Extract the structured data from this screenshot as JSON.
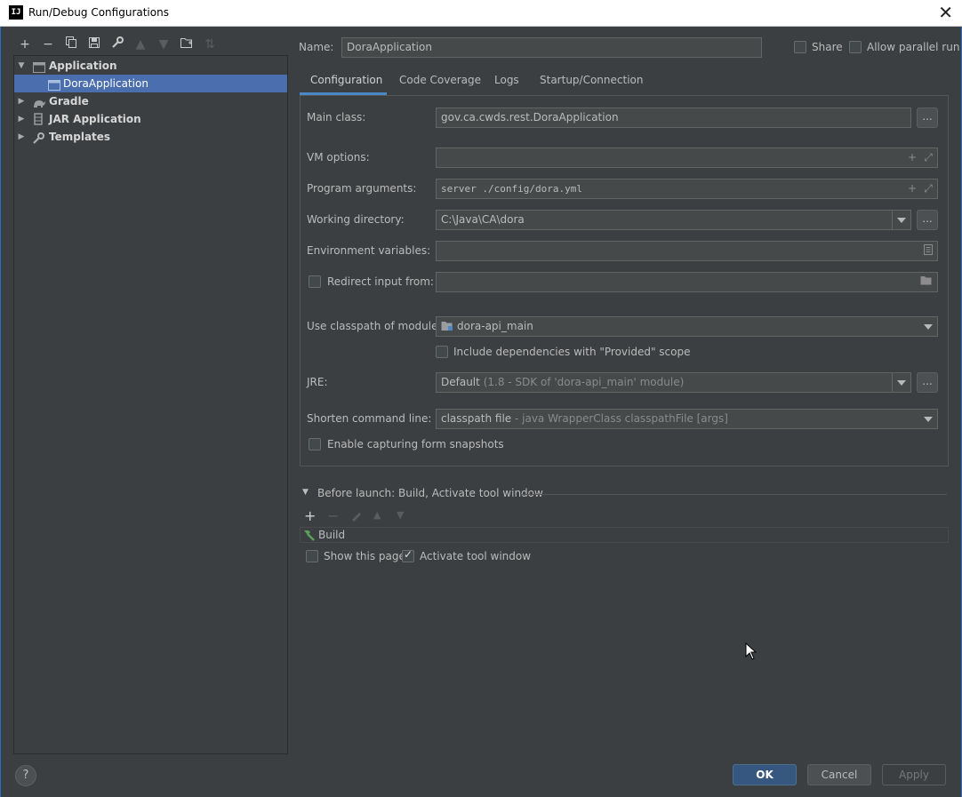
{
  "window": {
    "title": "Run/Debug Configurations",
    "app_icon": "IJ",
    "close": "✕"
  },
  "toolbar": {
    "icons": [
      "plus-icon",
      "minus-icon",
      "copy-icon",
      "save-icon",
      "wrench-icon",
      "arrow-up-icon",
      "arrow-down-icon",
      "folder-add-icon",
      "sort-icon"
    ]
  },
  "tree": {
    "items": [
      {
        "label": "Application",
        "expanded": true,
        "icon": "application-icon"
      },
      {
        "label": "DoraApplication",
        "selected": true,
        "icon": "application-config-icon"
      },
      {
        "label": "Gradle",
        "expanded": false,
        "icon": "gradle-icon"
      },
      {
        "label": "JAR Application",
        "expanded": false,
        "icon": "jar-icon"
      },
      {
        "label": "Templates",
        "expanded": false,
        "icon": "wrench-icon"
      }
    ]
  },
  "header": {
    "name_label": "Name:",
    "name_value": "DoraApplication",
    "share_label": "Share",
    "share_checked": false,
    "parallel_label": "Allow parallel run",
    "parallel_checked": false
  },
  "tabs": [
    {
      "label": "Configuration",
      "active": true
    },
    {
      "label": "Code Coverage",
      "active": false
    },
    {
      "label": "Logs",
      "active": false
    },
    {
      "label": "Startup/Connection",
      "active": false
    }
  ],
  "form": {
    "main_class_label": "Main class:",
    "main_class_value": "gov.ca.cwds.rest.DoraApplication",
    "vm_options_label": "VM options:",
    "vm_options_value": "",
    "program_args_label": "Program arguments:",
    "program_args_value": "server ./config/dora.yml",
    "working_dir_label": "Working directory:",
    "working_dir_value": "C:\\Java\\CA\\dora",
    "env_vars_label": "Environment variables:",
    "env_vars_value": "",
    "redirect_label": "Redirect input from:",
    "redirect_checked": false,
    "redirect_value": "",
    "classpath_label": "Use classpath of module:",
    "classpath_value": "dora-api_main",
    "include_deps_label": "Include dependencies with \"Provided\" scope",
    "include_deps_checked": false,
    "jre_label": "JRE:",
    "jre_value": "Default",
    "jre_detail": "(1.8 - SDK of 'dora-api_main' module)",
    "shorten_label": "Shorten command line:",
    "shorten_value": "classpath file",
    "shorten_detail": "- java WrapperClass classpathFile [args]",
    "snapshots_label": "Enable capturing form snapshots",
    "snapshots_checked": false,
    "browse_label": "..."
  },
  "before_launch": {
    "title": "Before launch: Build, Activate tool window",
    "tasks": [
      "Build"
    ],
    "show_page_label": "Show this page",
    "show_page_checked": false,
    "activate_label": "Activate tool window",
    "activate_checked": true
  },
  "buttons": {
    "ok": "OK",
    "cancel": "Cancel",
    "apply": "Apply",
    "help": "?"
  }
}
